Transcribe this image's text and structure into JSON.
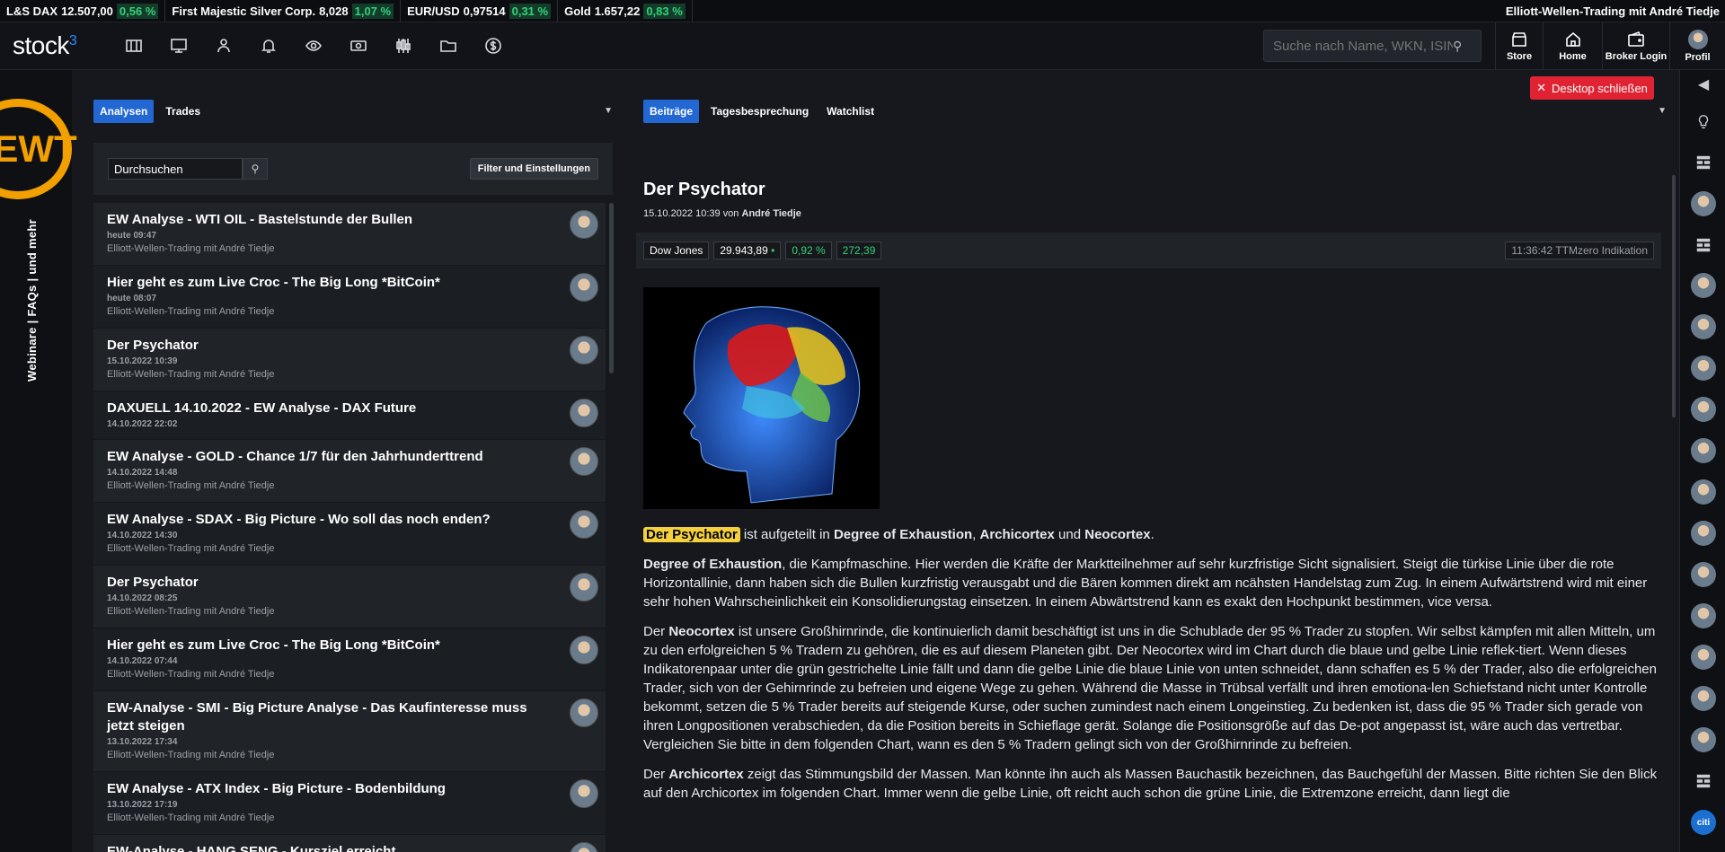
{
  "ticker": {
    "items": [
      {
        "name": "L&S DAX",
        "value": "12.507,00",
        "change": "0,56 %"
      },
      {
        "name": "First Majestic Silver Corp.",
        "value": "8,028",
        "change": "1,07 %"
      },
      {
        "name": "EUR/USD",
        "value": "0,97514",
        "change": "0,31 %"
      },
      {
        "name": "Gold",
        "value": "1.657,22",
        "change": "0,83 %"
      }
    ],
    "right_text": "Elliott-Wellen-Trading mit André Tiedje"
  },
  "header": {
    "logo": "stock",
    "logo_sup": "3",
    "search_placeholder": "Suche nach Name, WKN, ISIN",
    "store_label": "Store",
    "home_label": "Home",
    "broker_label": "Broker Login",
    "profile_label": "Profil",
    "close_desktop_label": "Desktop schließen"
  },
  "left_rail": {
    "logo_text": "EWT",
    "vertical_text": "Webinare | FAQs | und mehr"
  },
  "left_panel": {
    "tabs": [
      {
        "label": "Analysen"
      },
      {
        "label": "Trades"
      }
    ],
    "search_value": "Durchsuchen",
    "filter_button": "Filter und Einstellungen",
    "items": [
      {
        "title": "EW Analyse - WTI OIL - Bastelstunde der Bullen",
        "date": "heute 09:47",
        "author": "Elliott-Wellen-Trading mit André Tiedje"
      },
      {
        "title": "Hier geht es zum Live Croc - The Big Long *BitCoin*",
        "date": "heute 08:07",
        "author": "Elliott-Wellen-Trading mit André Tiedje"
      },
      {
        "title": "Der Psychator",
        "date": "15.10.2022 10:39",
        "author": "Elliott-Wellen-Trading mit André Tiedje"
      },
      {
        "title": "DAXUELL 14.10.2022 - EW Analyse - DAX Future",
        "date": "14.10.2022 22:02",
        "author": ""
      },
      {
        "title": "EW Analyse - GOLD - Chance 1/7 für den Jahrhunderttrend",
        "date": "14.10.2022 14:48",
        "author": "Elliott-Wellen-Trading mit André Tiedje"
      },
      {
        "title": "EW Analyse - SDAX - Big Picture - Wo soll das noch enden?",
        "date": "14.10.2022 14:30",
        "author": "Elliott-Wellen-Trading mit André Tiedje"
      },
      {
        "title": "Der Psychator",
        "date": "14.10.2022 08:25",
        "author": "Elliott-Wellen-Trading mit André Tiedje"
      },
      {
        "title": "Hier geht es zum Live Croc - The Big Long *BitCoin*",
        "date": "14.10.2022 07:44",
        "author": "Elliott-Wellen-Trading mit André Tiedje"
      },
      {
        "title": "EW-Analyse - SMI - Big Picture Analyse - Das Kaufinteresse muss jetzt steigen",
        "date": "13.10.2022 17:34",
        "author": "Elliott-Wellen-Trading mit André Tiedje"
      },
      {
        "title": "EW Analyse - ATX Index - Big Picture - Bodenbildung",
        "date": "13.10.2022 17:19",
        "author": "Elliott-Wellen-Trading mit André Tiedje"
      },
      {
        "title": "EW-Analyse - HANG SENG - Kursziel erreicht",
        "date": "",
        "author": ""
      }
    ]
  },
  "main": {
    "tabs": [
      {
        "label": "Beiträge"
      },
      {
        "label": "Tagesbesprechung"
      },
      {
        "label": "Watchlist"
      }
    ],
    "title": "Der Psychator",
    "meta_date": "15.10.2022 10:39 von",
    "meta_author": "André Tiedje",
    "quote": {
      "name": "Dow Jones",
      "value": "29.943,89",
      "dot": "•",
      "pct": "0,92 %",
      "abs": "272,39",
      "time": "11:36:42 TTMzero Indikation"
    },
    "p1": {
      "hl": "Der Psychator",
      "t1": " ist aufgeteilt in ",
      "b1": "Degree of Exhaustion",
      "t2": ", ",
      "b2": "Archicortex",
      "t3": " und ",
      "b3": "Neocortex",
      "t4": "."
    },
    "p2": {
      "b": "Degree of Exhaustion",
      "t": ", die Kampfmaschine. Hier werden die Kräfte der Marktteilnehmer auf sehr kurzfristige Sicht signalisiert. Steigt die türkise Linie über die rote Horizontallinie, dann haben sich die Bullen kurzfristig verausgabt und die Bären kommen direkt am ncähsten Handelstag zum Zug. In einem Aufwärtstrend wird mit einer sehr hohen Wahrscheinlichkeit ein Konsolidierungstag einsetzen. In einem Abwärtstrend kann es exakt den Hochpunkt bestimmen, vice versa."
    },
    "p3": {
      "t0": "Der ",
      "b": "Neocortex",
      "t": " ist unsere Großhirnrinde, die kontinuierlich damit beschäftigt ist uns in die Schublade der 95 % Trader zu stopfen. Wir selbst kämpfen mit allen Mitteln, um zu den erfolgreichen 5 % Tradern zu gehören, die es auf diesem Planeten gibt. Der Neocortex wird im Chart durch die blaue und gelbe Linie reflek-tiert. Wenn dieses Indikatorenpaar unter die grün gestrichelte Linie fällt und dann die gelbe Linie die blaue Linie von unten schneidet, dann schaffen es 5 % der Trader, also die erfolgreichen Trader, sich von der Gehirnrinde zu befreien und eigene Wege zu gehen. Während die Masse in Trübsal verfällt und ihren emotiona-len Schiefstand nicht unter Kontrolle bekommt, setzen die 5 % Trader bereits auf steigende Kurse, oder suchen zumindest nach einem Longeinstieg. Zu bedenken ist, dass die 95 % Trader sich gerade von ihren Longpositionen verabschieden, da die Position bereits in Schieflage gerät. Solange die Positionsgröße auf das De-pot angepasst ist, wäre auch das vertretbar. Vergleichen Sie bitte in dem folgenden Chart, wann es den 5 % Tradern gelingt sich von der Großhirnrinde zu befreien."
    },
    "p4": {
      "t0": "Der ",
      "b": "Archicortex",
      "t": " zeigt das Stimmungsbild der Massen. Man könnte ihn auch als Massen Bauchastik bezeichnen, das Bauchgefühl der Massen. Bitte richten Sie den Blick auf den Archicortex im folgenden Chart. Immer wenn die gelbe Linie, oft reicht auch schon die grüne Linie, die Extremzone erreicht, dann liegt die"
    }
  },
  "right_rail": {
    "citi": "citi"
  },
  "colors": {
    "accent": "#2367d3",
    "positive": "#33d17a",
    "ewt": "#f2a000",
    "close": "#e02333"
  }
}
